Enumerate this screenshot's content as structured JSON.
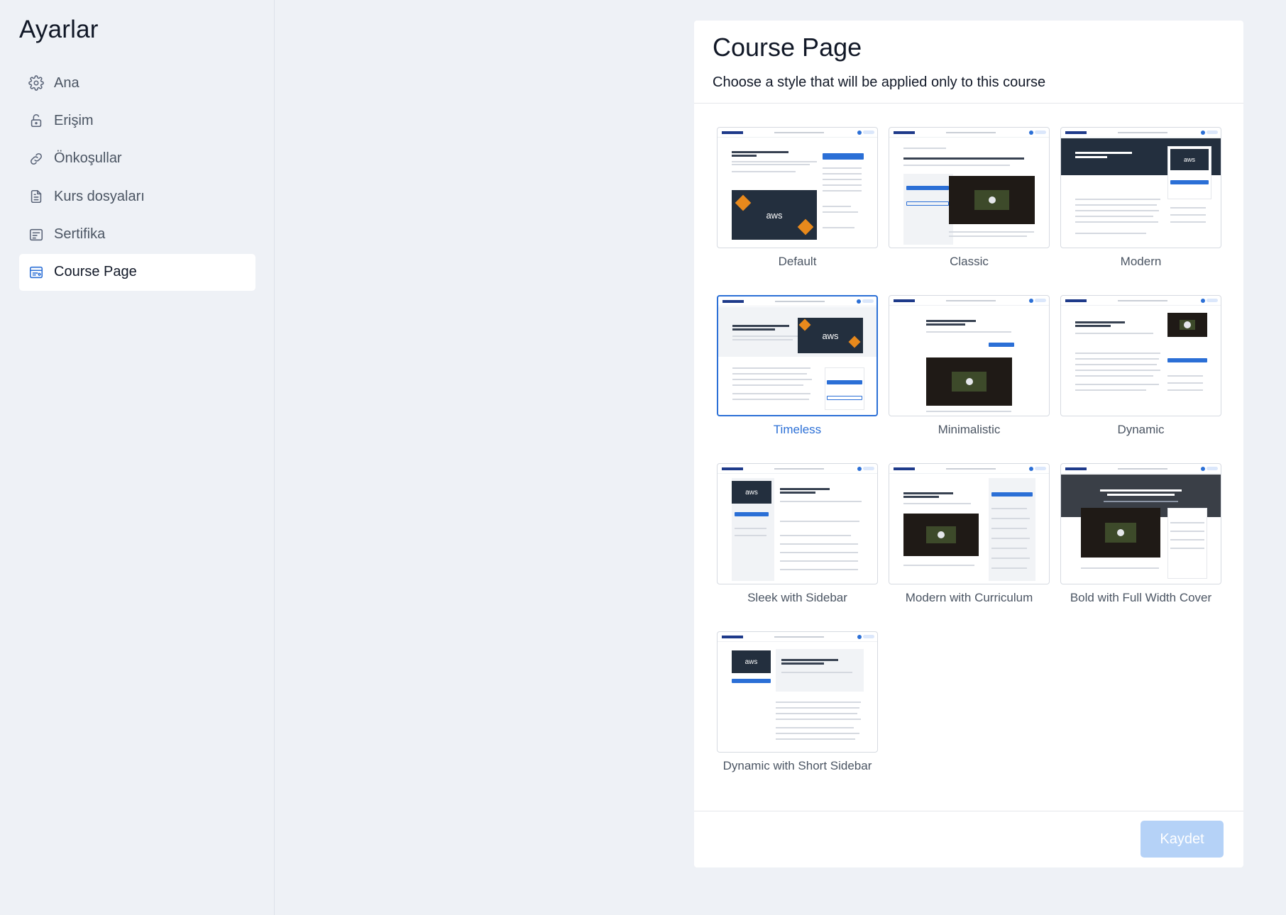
{
  "sidebar": {
    "title": "Ayarlar",
    "items": [
      {
        "label": "Ana",
        "icon": "gear-icon"
      },
      {
        "label": "Erişim",
        "icon": "lock-icon"
      },
      {
        "label": "Önkoşullar",
        "icon": "link-icon"
      },
      {
        "label": "Kurs dosyaları",
        "icon": "document-icon"
      },
      {
        "label": "Sertifika",
        "icon": "certificate-icon"
      },
      {
        "label": "Course Page",
        "icon": "course-page-icon",
        "active": true
      }
    ]
  },
  "panel": {
    "title": "Course Page",
    "subtitle": "Choose a style that will be applied only to this course",
    "save_label": "Kaydet",
    "selected_style": "Timeless",
    "styles": [
      {
        "label": "Default"
      },
      {
        "label": "Classic"
      },
      {
        "label": "Modern"
      },
      {
        "label": "Timeless"
      },
      {
        "label": "Minimalistic"
      },
      {
        "label": "Dynamic"
      },
      {
        "label": "Sleek with Sidebar"
      },
      {
        "label": "Modern with Curriculum"
      },
      {
        "label": "Bold with Full Width Cover"
      },
      {
        "label": "Dynamic with Short Sidebar"
      }
    ]
  },
  "colors": {
    "accent": "#2b6fd6",
    "save_button_disabled": "#b5d2f7",
    "page_background": "#eef1f6"
  }
}
